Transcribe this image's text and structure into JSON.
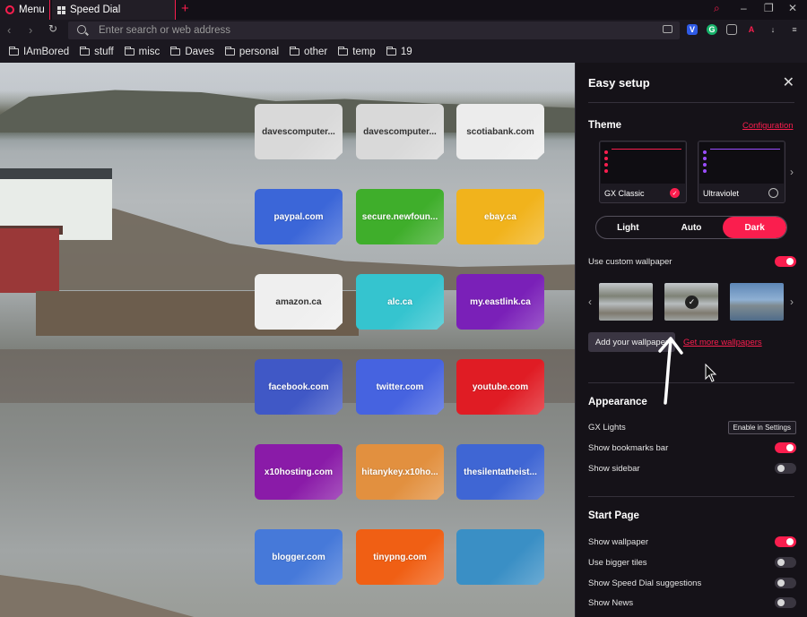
{
  "tabbar": {
    "menu_label": "Menu",
    "tab_title": "Speed Dial",
    "new_tab": "+"
  },
  "addressbar": {
    "placeholder": "Enter search or web address"
  },
  "bookmarks": [
    "IAmBored",
    "stuff",
    "misc",
    "Daves",
    "personal",
    "other",
    "temp",
    "19"
  ],
  "speed_dial": [
    {
      "label": "davescomputer...",
      "color": "#d9d9d9",
      "light": true
    },
    {
      "label": "davescomputer...",
      "color": "#d9d9d9",
      "light": true
    },
    {
      "label": "scotiabank.com",
      "color": "#ececec",
      "light": true
    },
    {
      "label": "paypal.com",
      "color": "#3b66d8"
    },
    {
      "label": "secure.newfoun...",
      "color": "#3fae2b"
    },
    {
      "label": "ebay.ca",
      "color": "#f1b31c"
    },
    {
      "label": "amazon.ca",
      "color": "#efefef",
      "light": true
    },
    {
      "label": "alc.ca",
      "color": "#35c4cf"
    },
    {
      "label": "my.eastlink.ca",
      "color": "#7a20b8"
    },
    {
      "label": "facebook.com",
      "color": "#4058c6"
    },
    {
      "label": "twitter.com",
      "color": "#4663e0"
    },
    {
      "label": "youtube.com",
      "color": "#e01c24"
    },
    {
      "label": "x10hosting.com",
      "color": "#8a1ba8"
    },
    {
      "label": "hitanykey.x10ho...",
      "color": "#e2903f"
    },
    {
      "label": "thesilentatheist...",
      "color": "#3f66d4"
    },
    {
      "label": "blogger.com",
      "color": "#4679d9"
    },
    {
      "label": "tinypng.com",
      "color": "#f05f14"
    },
    {
      "label": "",
      "color": "#3a8fc5"
    }
  ],
  "panel": {
    "title": "Easy setup",
    "theme_heading": "Theme",
    "configuration_link": "Configuration",
    "themes": [
      {
        "name": "GX Classic",
        "accent": "#fa1e4e",
        "selected": true
      },
      {
        "name": "Ultraviolet",
        "accent": "#9b4dff",
        "selected": false
      }
    ],
    "modes": [
      "Light",
      "Auto",
      "Dark"
    ],
    "active_mode": "Dark",
    "use_custom_wallpaper": "Use custom wallpaper",
    "add_wallpaper": "Add your wallpaper",
    "more_wallpapers": "Get more wallpapers",
    "appearance_heading": "Appearance",
    "gx_lights": "GX Lights",
    "enable_in_settings": "Enable in Settings",
    "show_bookmarks_bar": "Show bookmarks bar",
    "show_sidebar": "Show sidebar",
    "start_page_heading": "Start Page",
    "show_wallpaper": "Show wallpaper",
    "use_bigger_tiles": "Use bigger tiles",
    "show_speed_dial_suggestions": "Show Speed Dial suggestions",
    "show_news": "Show News"
  },
  "colors": {
    "accent": "#fa1e4e",
    "panel_bg": "#151218"
  }
}
